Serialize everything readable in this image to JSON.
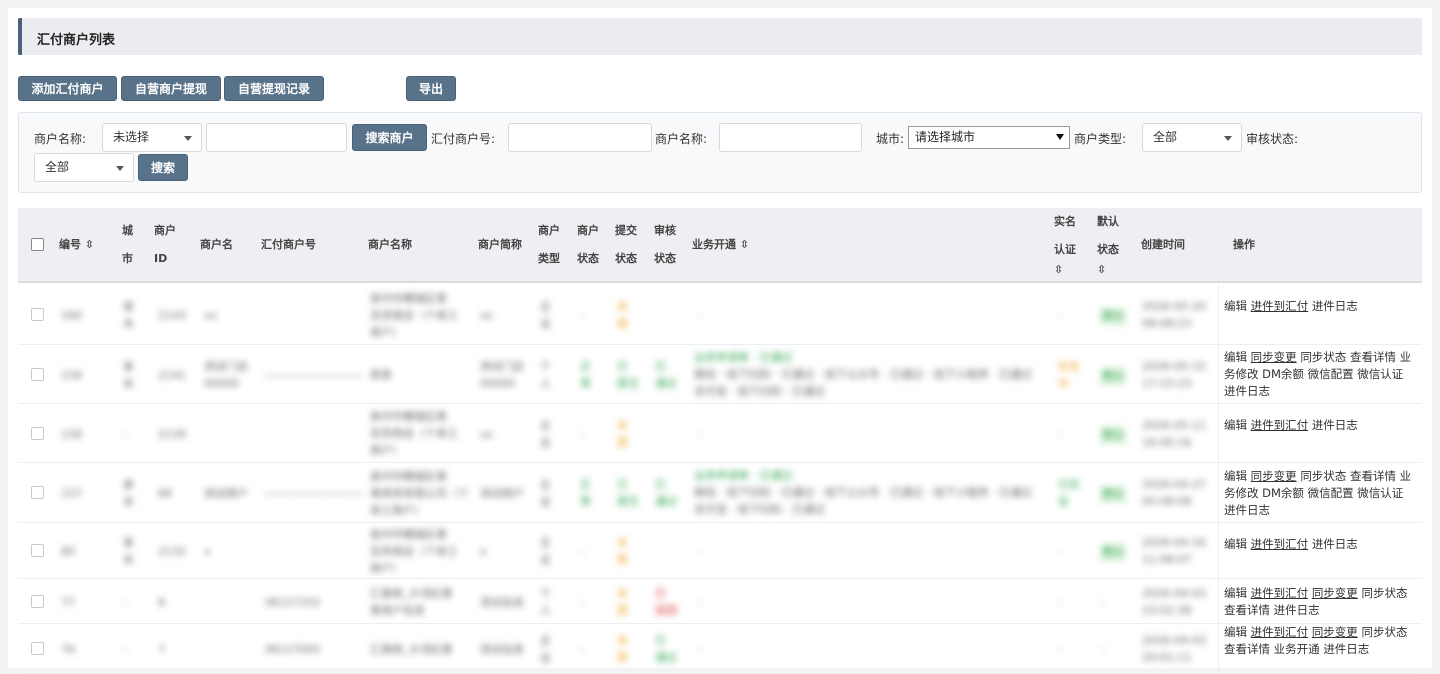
{
  "page_title": "汇付商户列表",
  "toolbar": {
    "add": "添加汇付商户",
    "withdraw": "自营商户提现",
    "records": "自营提现记录",
    "export": "导出"
  },
  "filter": {
    "merchant_name_label": "商户名称:",
    "merchant_select_value": "未选择",
    "search_merchant": "搜索商户",
    "huifu_no_label": "汇付商户号:",
    "merchant_name_label2": "商户名称:",
    "city_label": "城市:",
    "city_value": "请选择城市",
    "type_label": "商户类型:",
    "type_value": "全部",
    "audit_label": "审核状态:",
    "audit_value": "全部",
    "search": "搜索"
  },
  "columns": {
    "id": "编号",
    "city": [
      "城",
      "市"
    ],
    "merchant_id": [
      "商户",
      "ID"
    ],
    "merchant_nick": "商户名",
    "huifu_no": "汇付商户号",
    "merchant_name": "商户名称",
    "short_name": "商户简称",
    "merchant_type": [
      "商户",
      "类型"
    ],
    "merchant_status": [
      "商户",
      "状态"
    ],
    "submit_status": [
      "提交",
      "状态"
    ],
    "audit_status": [
      "审核",
      "状态"
    ],
    "business": "业务开通",
    "realname": [
      "实名",
      "认证"
    ],
    "default_status": [
      "默认",
      "状态"
    ],
    "created_at": "创建时间",
    "actions": "操作"
  },
  "rows": [
    {
      "id": "160",
      "city": [
        "泉",
        "永"
      ],
      "mid": "2143",
      "nick": "xx",
      "huifu": "",
      "name": [
        "泉州市鲤城区某",
        "百货商店（个体工",
        "商户）"
      ],
      "short": "xx",
      "type": [
        "企",
        "业"
      ],
      "mstatus": "-",
      "submit": [
        "未",
        "提"
      ],
      "audit": "",
      "business": "-",
      "realname": "-",
      "default": "默认",
      "created": [
        "2026-05-20",
        "08:08:23"
      ],
      "ops": [
        "编辑",
        "进件到汇付",
        "进件日志"
      ]
    },
    {
      "id": "159",
      "city": [
        "泉",
        "永"
      ],
      "mid": "2141",
      "nick": "测试门店00000",
      "huifu": "—————————",
      "name": [
        "泉泉"
      ],
      "short": "测试门店00000",
      "type": [
        "个",
        "人"
      ],
      "mstatus": "正常",
      "submit": [
        "已",
        "提交"
      ],
      "audit": [
        "已",
        "通过"
      ],
      "business": "业务申请单 · 已通过",
      "realname": "实名中",
      "default": "默认",
      "created": [
        "2026-05-15",
        "17:15:23"
      ],
      "ops": [
        "编辑",
        "同步变更",
        "同步状态",
        "查看详情",
        "业务修改",
        "DM余额",
        "微信配置",
        "微信认证",
        "进件日志"
      ]
    },
    {
      "id": "158",
      "city": [
        "-"
      ],
      "mid": "2139",
      "nick": "",
      "huifu": "",
      "name": [
        "泉州市鲤城区某",
        "百货商店（个体工",
        "商户）"
      ],
      "short": "xx",
      "type": [
        "企",
        "业"
      ],
      "mstatus": "-",
      "submit": [
        "未",
        "提"
      ],
      "audit": "",
      "business": "-",
      "realname": "-",
      "default": "默认",
      "created": [
        "2026-05-11",
        "16:00:16"
      ],
      "ops": [
        "编辑",
        "进件到汇付",
        "进件日志"
      ]
    },
    {
      "id": "157",
      "city": [
        "泉",
        "永"
      ],
      "mid": "68",
      "nick": "测试商户",
      "huifu": "—————————",
      "name": [
        "泉州市鲤城区某",
        "某商贸有限公司（个",
        "体工商户）"
      ],
      "short": "测试商户",
      "type": [
        "企",
        "业"
      ],
      "mstatus": "正常",
      "submit": [
        "已",
        "提交"
      ],
      "audit": [
        "已",
        "通过"
      ],
      "business": "业务申请单 · 已通过",
      "realname": "已实名",
      "default": "默认",
      "created": [
        "2026-04-27",
        "05:08:08"
      ],
      "ops": [
        "编辑",
        "同步变更",
        "同步状态",
        "查看详情",
        "业务修改",
        "DM余额",
        "微信配置",
        "微信认证",
        "进件日志"
      ]
    },
    {
      "id": "80",
      "city": [
        "泉",
        "永"
      ],
      "mid": "2132",
      "nick": "x",
      "huifu": "",
      "name": [
        "泉州市鲤城区某",
        "百货商店（个体工",
        "商户）"
      ],
      "short": "x",
      "type": [
        "企",
        "业"
      ],
      "mstatus": "-",
      "submit": [
        "未",
        "提"
      ],
      "audit": "",
      "business": "-",
      "realname": "-",
      "default": "默认",
      "created": [
        "2026-04-16",
        "11:08:07"
      ],
      "ops": [
        "编辑",
        "进件到汇付",
        "进件日志"
      ]
    },
    {
      "id": "77",
      "city": [
        "-"
      ],
      "mid": "8",
      "nick": "",
      "huifu": "38127103",
      "name": [
        "汇旗商_大湾区某",
        "某商户信息"
      ],
      "short": "测试信息",
      "type": [
        "个",
        "人"
      ],
      "mstatus": "-",
      "submit": [
        "未",
        "提"
      ],
      "audit": [
        "已",
        "驳回"
      ],
      "business": "-",
      "realname": "-",
      "default": "-",
      "created": [
        "2026-04-03",
        "23:02:38"
      ],
      "ops": [
        "编辑",
        "进件到汇付",
        "同步变更",
        "同步状态",
        "查看详情",
        "进件日志"
      ]
    },
    {
      "id": "76",
      "city": [
        "-"
      ],
      "mid": "7",
      "nick": "",
      "huifu": "38127093",
      "name": [
        "汇旗商_大湾区某"
      ],
      "short": "测试信息",
      "type": [
        "企",
        "业"
      ],
      "mstatus": "-",
      "submit": [
        "未",
        "提"
      ],
      "audit": [
        "已",
        "通过"
      ],
      "business": "-",
      "realname": "-",
      "default": "-",
      "created": [
        "2026-04-03",
        "20:01:11"
      ],
      "ops": [
        "编辑",
        "进件到汇付",
        "同步变更",
        "同步状态",
        "查看详情",
        "业务开通",
        "进件日志"
      ]
    }
  ]
}
